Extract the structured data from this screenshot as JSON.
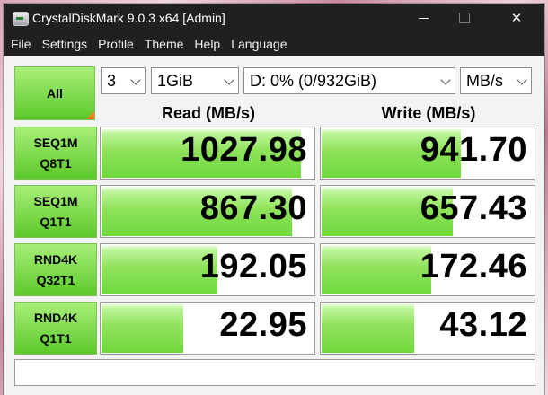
{
  "window": {
    "title": "CrystalDiskMark 9.0.3 x64 [Admin]",
    "controls": {
      "minimize": "",
      "maximize": "",
      "close": "✕"
    }
  },
  "menu": [
    "File",
    "Settings",
    "Profile",
    "Theme",
    "Help",
    "Language"
  ],
  "toolbar": {
    "all_label": "All",
    "count": "3",
    "size": "1GiB",
    "drive": "D: 0% (0/932GiB)",
    "unit": "MB/s"
  },
  "headers": {
    "read": "Read (MB/s)",
    "write": "Write (MB/s)"
  },
  "tests": [
    {
      "line1": "SEQ1M",
      "line2": "Q8T1",
      "read": "1027.98",
      "write": "941.70",
      "read_fill": 0.94,
      "write_fill": 0.66
    },
    {
      "line1": "SEQ1M",
      "line2": "Q1T1",
      "read": "867.30",
      "write": "657.43",
      "read_fill": 0.9,
      "write_fill": 0.62
    },
    {
      "line1": "RND4K",
      "line2": "Q32T1",
      "read": "192.05",
      "write": "172.46",
      "read_fill": 0.55,
      "write_fill": 0.52
    },
    {
      "line1": "RND4K",
      "line2": "Q1T1",
      "read": "22.95",
      "write": "43.12",
      "read_fill": 0.39,
      "write_fill": 0.44
    }
  ],
  "status_text": "",
  "colors": {
    "accent_green": "#6fd93b",
    "titlebar": "#202020",
    "corner_mark": "#ff7a1a"
  }
}
